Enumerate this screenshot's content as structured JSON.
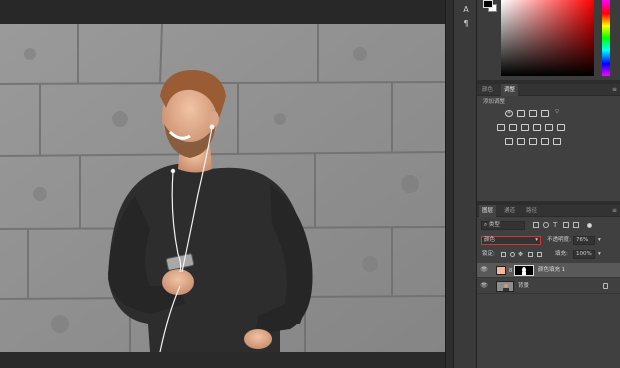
{
  "colors": {
    "fill_swatch": "#f3b79c",
    "highlight_border": "#d83434"
  },
  "icons": [
    "text-tool-icon",
    "paragraph-icon",
    "foreground-swatch",
    "background-swatch"
  ],
  "tool_strip": {
    "char_label": "A",
    "para_label": "¶"
  },
  "mid_panel": {
    "tabs": [
      "颜色",
      "调整"
    ],
    "active_tab": "调整",
    "adjust_label": "添加调整"
  },
  "layers_panel": {
    "tabs": [
      "图层",
      "通道",
      "路径"
    ],
    "active_tab": "图层",
    "filter_kind": "类型",
    "blend_mode": "颜色",
    "opacity_label": "不透明度:",
    "opacity_value": "76%",
    "lock_label": "锁定:",
    "fill_label": "填充:",
    "fill_value": "100%",
    "layers": [
      {
        "name": "颜色填充 1",
        "selected": true
      },
      {
        "name": "背景",
        "selected": false
      }
    ]
  }
}
